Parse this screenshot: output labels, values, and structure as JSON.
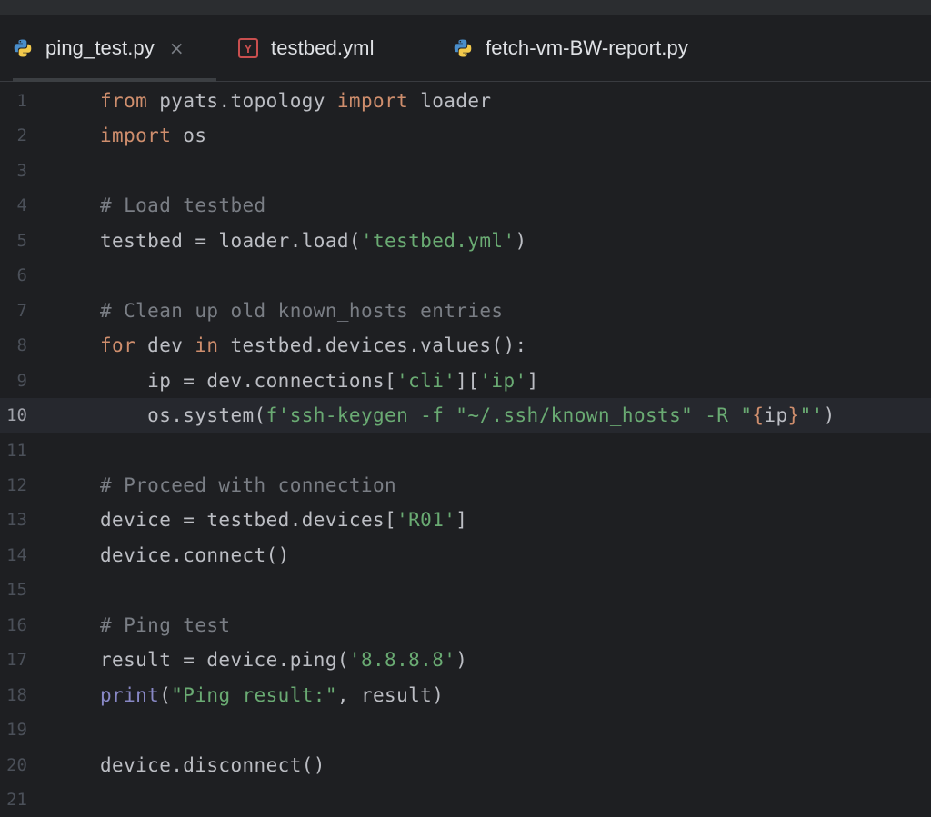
{
  "tabs": [
    {
      "label": "ping_test.py",
      "icon": "python-icon",
      "active": true,
      "close": "×"
    },
    {
      "label": "testbed.yml",
      "icon": "yaml-icon",
      "icon_text": "Y",
      "active": false
    },
    {
      "label": "fetch-vm-BW-report.py",
      "icon": "python-icon",
      "active": false
    }
  ],
  "editor": {
    "current_line": 10,
    "lines": [
      {
        "n": "1",
        "tokens": [
          [
            "k",
            "from"
          ],
          [
            "p",
            " pyats.topology "
          ],
          [
            "k",
            "import"
          ],
          [
            "p",
            " loader"
          ]
        ]
      },
      {
        "n": "2",
        "tokens": [
          [
            "k",
            "import"
          ],
          [
            "p",
            " os"
          ]
        ]
      },
      {
        "n": "3",
        "tokens": []
      },
      {
        "n": "4",
        "tokens": [
          [
            "c",
            "# Load testbed"
          ]
        ]
      },
      {
        "n": "5",
        "tokens": [
          [
            "p",
            "testbed = loader.load("
          ],
          [
            "s",
            "'testbed.yml'"
          ],
          [
            "p",
            ")"
          ]
        ]
      },
      {
        "n": "6",
        "tokens": []
      },
      {
        "n": "7",
        "tokens": [
          [
            "c",
            "# Clean up old known_hosts entries"
          ]
        ]
      },
      {
        "n": "8",
        "tokens": [
          [
            "k",
            "for"
          ],
          [
            "p",
            " dev "
          ],
          [
            "k",
            "in"
          ],
          [
            "p",
            " testbed.devices.values():"
          ]
        ]
      },
      {
        "n": "9",
        "tokens": [
          [
            "p",
            "    ip = dev.connections["
          ],
          [
            "s",
            "'cli'"
          ],
          [
            "p",
            "]["
          ],
          [
            "s",
            "'ip'"
          ],
          [
            "p",
            "]"
          ]
        ]
      },
      {
        "n": "10",
        "tokens": [
          [
            "p",
            "    os.system("
          ],
          [
            "s",
            "f'ssh-keygen -f \"~/.ssh/known_hosts\" -R \""
          ],
          [
            "k",
            "{"
          ],
          [
            "p",
            "ip"
          ],
          [
            "k",
            "}"
          ],
          [
            "s",
            "\"'"
          ],
          [
            "p",
            ")"
          ]
        ]
      },
      {
        "n": "11",
        "tokens": []
      },
      {
        "n": "12",
        "tokens": [
          [
            "c",
            "# Proceed with connection"
          ]
        ]
      },
      {
        "n": "13",
        "tokens": [
          [
            "p",
            "device = testbed.devices["
          ],
          [
            "s",
            "'R01'"
          ],
          [
            "p",
            "]"
          ]
        ]
      },
      {
        "n": "14",
        "tokens": [
          [
            "p",
            "device.connect()"
          ]
        ]
      },
      {
        "n": "15",
        "tokens": []
      },
      {
        "n": "16",
        "tokens": [
          [
            "c",
            "# Ping test"
          ]
        ]
      },
      {
        "n": "17",
        "tokens": [
          [
            "p",
            "result = device.ping("
          ],
          [
            "s",
            "'8.8.8.8'"
          ],
          [
            "p",
            ")"
          ]
        ]
      },
      {
        "n": "18",
        "tokens": [
          [
            "b",
            "print"
          ],
          [
            "p",
            "("
          ],
          [
            "s",
            "\"Ping result:\""
          ],
          [
            "p",
            ", result)"
          ]
        ]
      },
      {
        "n": "19",
        "tokens": []
      },
      {
        "n": "20",
        "tokens": [
          [
            "p",
            "device.disconnect()"
          ]
        ]
      },
      {
        "n": "21",
        "tokens": []
      }
    ]
  },
  "colors": {
    "background": "#1e1f22",
    "keyword": "#cf8e6d",
    "string": "#6aab73",
    "comment": "#7a7e85",
    "builtin": "#8888c6",
    "text": "#bcbec4"
  }
}
